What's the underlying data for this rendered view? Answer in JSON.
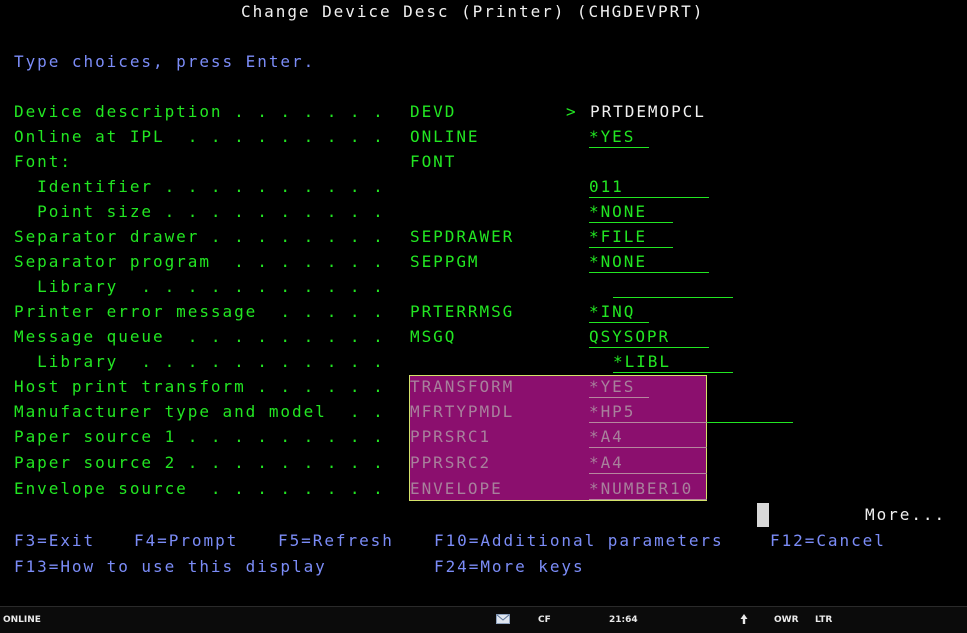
{
  "header": {
    "title": "Change Device Desc (Printer) (CHGDEVPRT)",
    "instructions": "Type choices, press Enter."
  },
  "params": [
    {
      "label": "Device description . . . . . . .",
      "keyword": "DEVD",
      "marker": ">",
      "value": "PRTDEMOPCL"
    },
    {
      "label": "Online at IPL  . . . . . . . . .",
      "keyword": "ONLINE",
      "value": "*YES"
    },
    {
      "label": "Font:",
      "keyword": "FONT"
    },
    {
      "label": "  Identifier . . . . . . . . . .",
      "value": "011"
    },
    {
      "label": "  Point size . . . . . . . . . .",
      "value": "*NONE"
    },
    {
      "label": "Separator drawer . . . . . . . .",
      "keyword": "SEPDRAWER",
      "value": "*FILE"
    },
    {
      "label": "Separator program  . . . . . . .",
      "keyword": "SEPPGM",
      "value": "*NONE"
    },
    {
      "label": "  Library  . . . . . . . . . . .",
      "value": ""
    },
    {
      "label": "Printer error message  . . . . .",
      "keyword": "PRTERRMSG",
      "value": "*INQ"
    },
    {
      "label": "Message queue  . . . . . . . . .",
      "keyword": "MSGQ",
      "value": "QSYSOPR"
    },
    {
      "label": "  Library  . . . . . . . . . . .",
      "value": "*LIBL"
    },
    {
      "label": "Host print transform . . . . . .",
      "keyword": "TRANSFORM",
      "value": "*YES"
    },
    {
      "label": "Manufacturer type and model  . .",
      "keyword": "MFRTYPMDL",
      "value": "*HP5"
    },
    {
      "label": "Paper source 1 . . . . . . . . .",
      "keyword": "PPRSRC1",
      "value": "*A4"
    },
    {
      "label": "Paper source 2 . . . . . . . . .",
      "keyword": "PPRSRC2",
      "value": "*A4"
    },
    {
      "label": "Envelope source  . . . . . . . .",
      "keyword": "ENVELOPE",
      "value": "*NUMBER10"
    }
  ],
  "more": "More...",
  "fkeys": {
    "f3": "F3=Exit",
    "f4": "F4=Prompt",
    "f5": "F5=Refresh",
    "f10": "F10=Additional parameters",
    "f12": "F12=Cancel",
    "f13": "F13=How to use this display",
    "f24": "F24=More keys"
  },
  "status": {
    "mode": "ONLINE",
    "cf": "CF",
    "position": "21:64",
    "owner": "OWR",
    "direction": "LTR"
  },
  "icons": {
    "message": "envelope-icon",
    "shift": "up-arrow-icon"
  },
  "colors": {
    "background": "#000000",
    "text_white": "#f0f0f0",
    "text_green": "#22e622",
    "text_blue": "#7b8cf7",
    "highlight": "#8b0f6e",
    "highlight_border": "#d4e26a"
  }
}
